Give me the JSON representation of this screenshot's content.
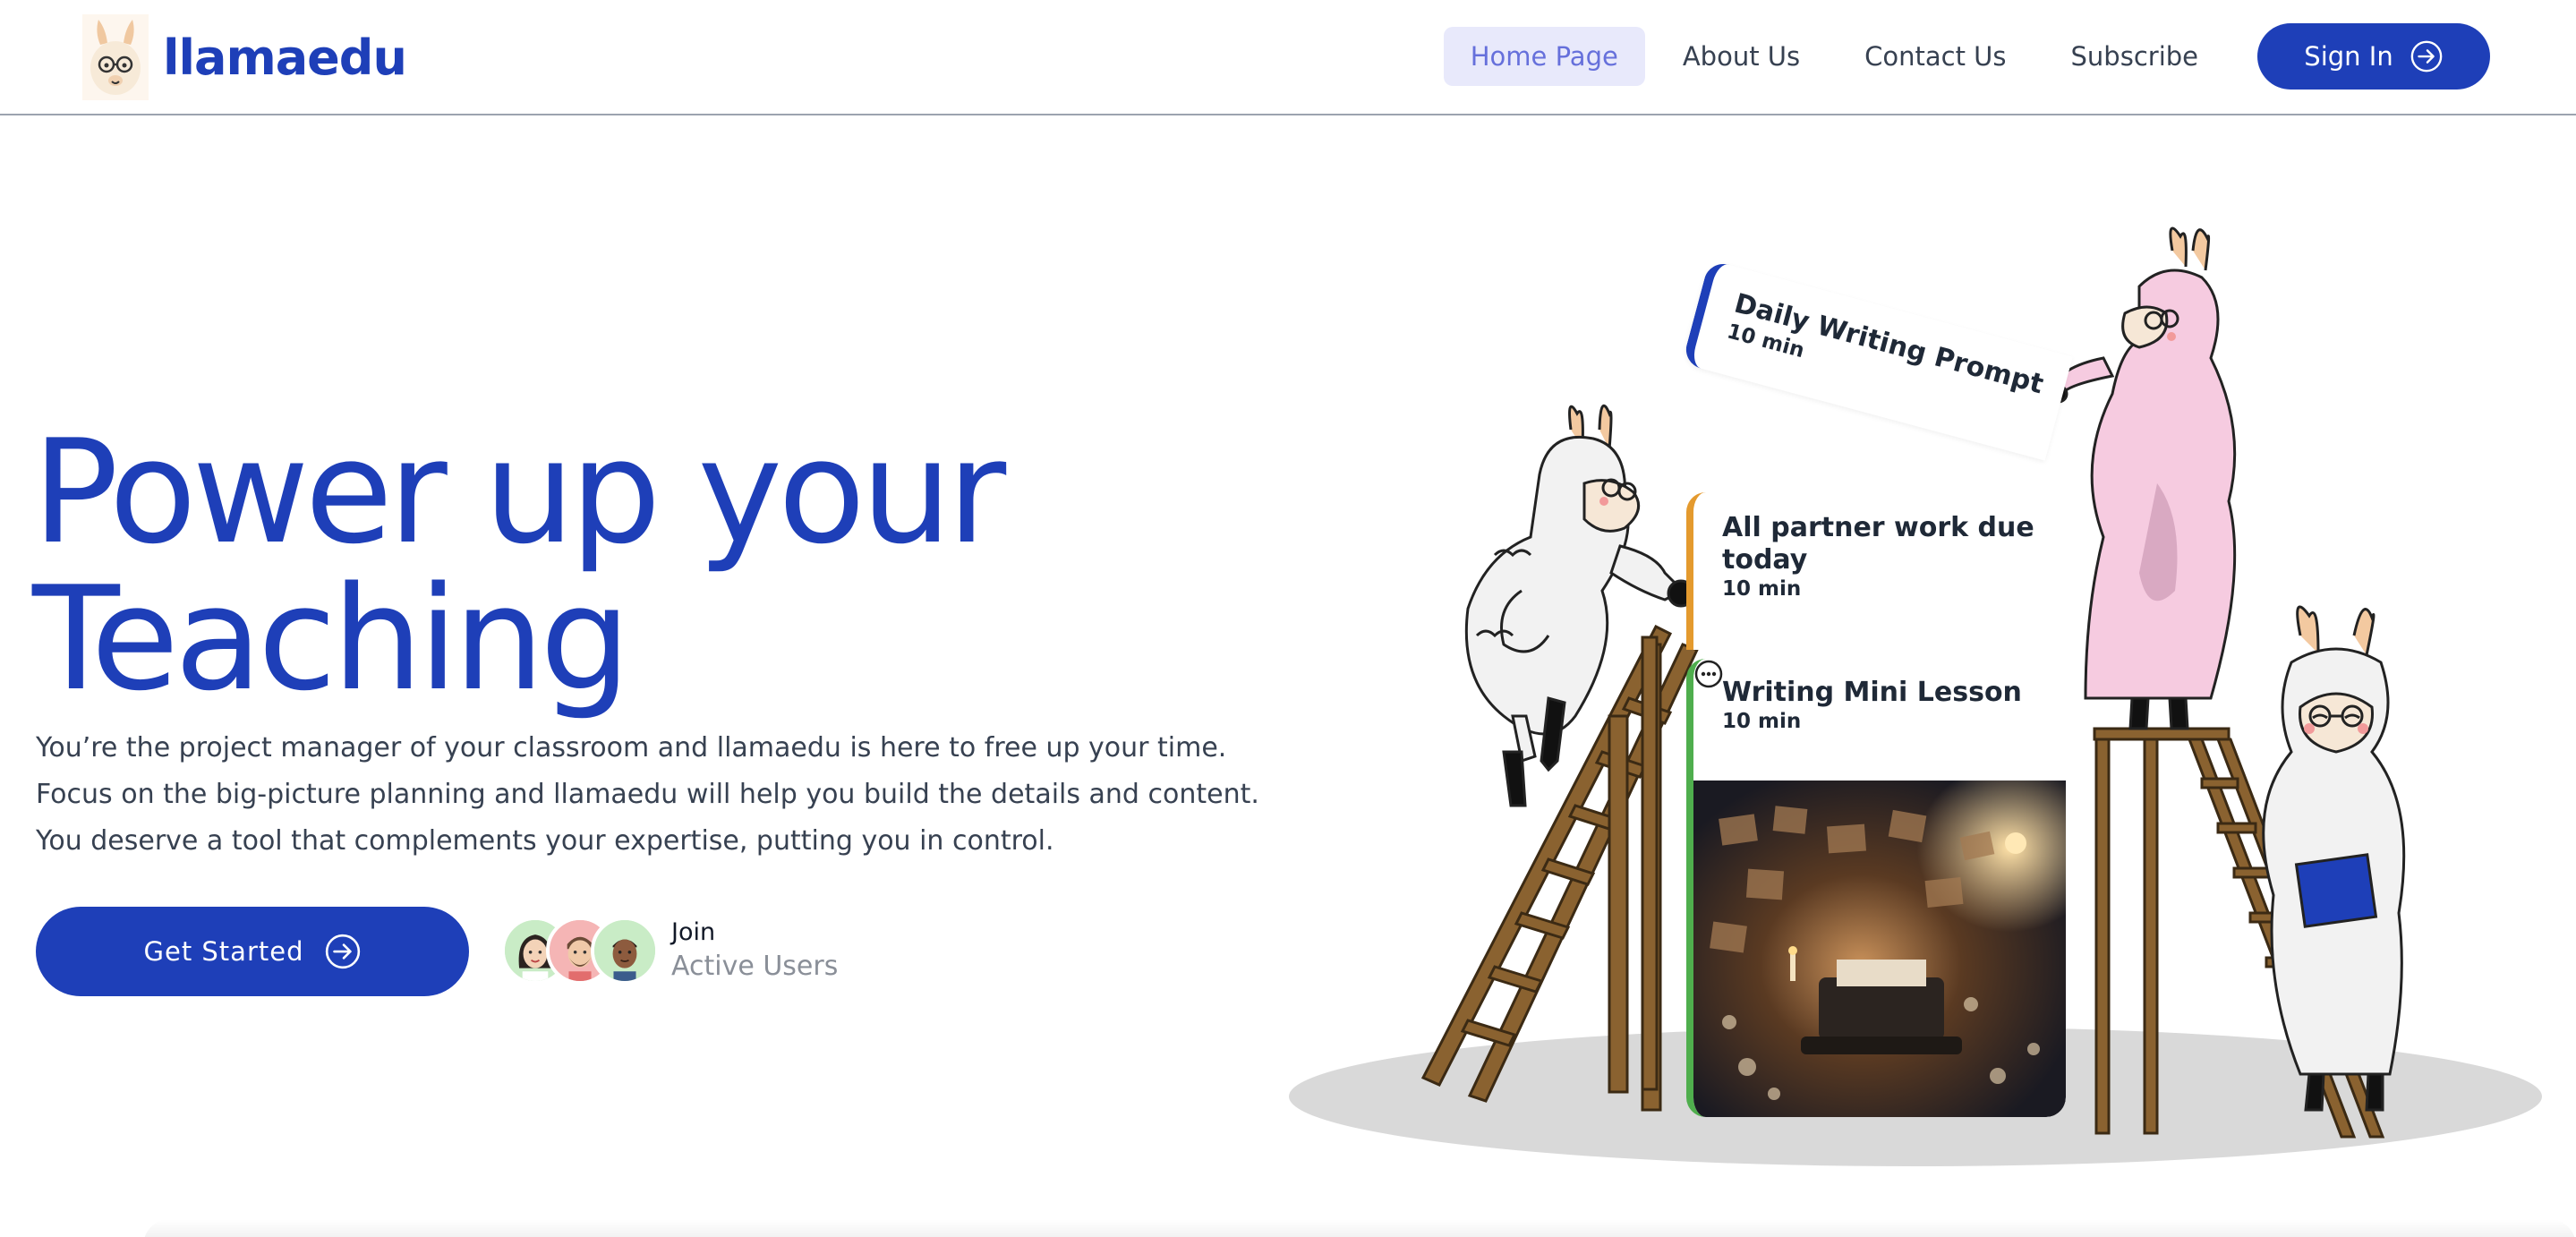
{
  "brand": {
    "name": "llamaedu"
  },
  "nav": {
    "items": [
      {
        "label": "Home Page",
        "active": true
      },
      {
        "label": "About Us",
        "active": false
      },
      {
        "label": "Contact Us",
        "active": false
      },
      {
        "label": "Subscribe",
        "active": false
      }
    ],
    "sign_in_label": "Sign In"
  },
  "hero": {
    "title_line1": "Power up your",
    "title_line2": "Teaching",
    "description": "You’re the project manager of your classroom and llamaedu is here to free up your time. Focus on the big-picture planning and llamaedu will help you build the details and content. You deserve a tool that complements your expertise, putting you in control.",
    "cta_label": "Get Started",
    "users_join": "Join",
    "users_active": "Active Users"
  },
  "cards": {
    "daily": {
      "title": "Daily Writing Prompt",
      "meta": "10 min",
      "accent": "#1e3fb8"
    },
    "partner": {
      "title": "All partner work due today",
      "meta": "10 min",
      "accent": "#e49a2e"
    },
    "mini": {
      "title": "Writing Mini Lesson",
      "meta": "10 min",
      "accent": "#4fae4d"
    }
  },
  "colors": {
    "brand": "#1e3fb8",
    "nav_active_bg": "#e8e9fb",
    "nav_active_text": "#6670db"
  },
  "icons": {
    "cta": "arrow-right-circle-icon",
    "sign_in": "arrow-right-circle-icon",
    "card_menu": "more-horizontal-circle-icon"
  }
}
